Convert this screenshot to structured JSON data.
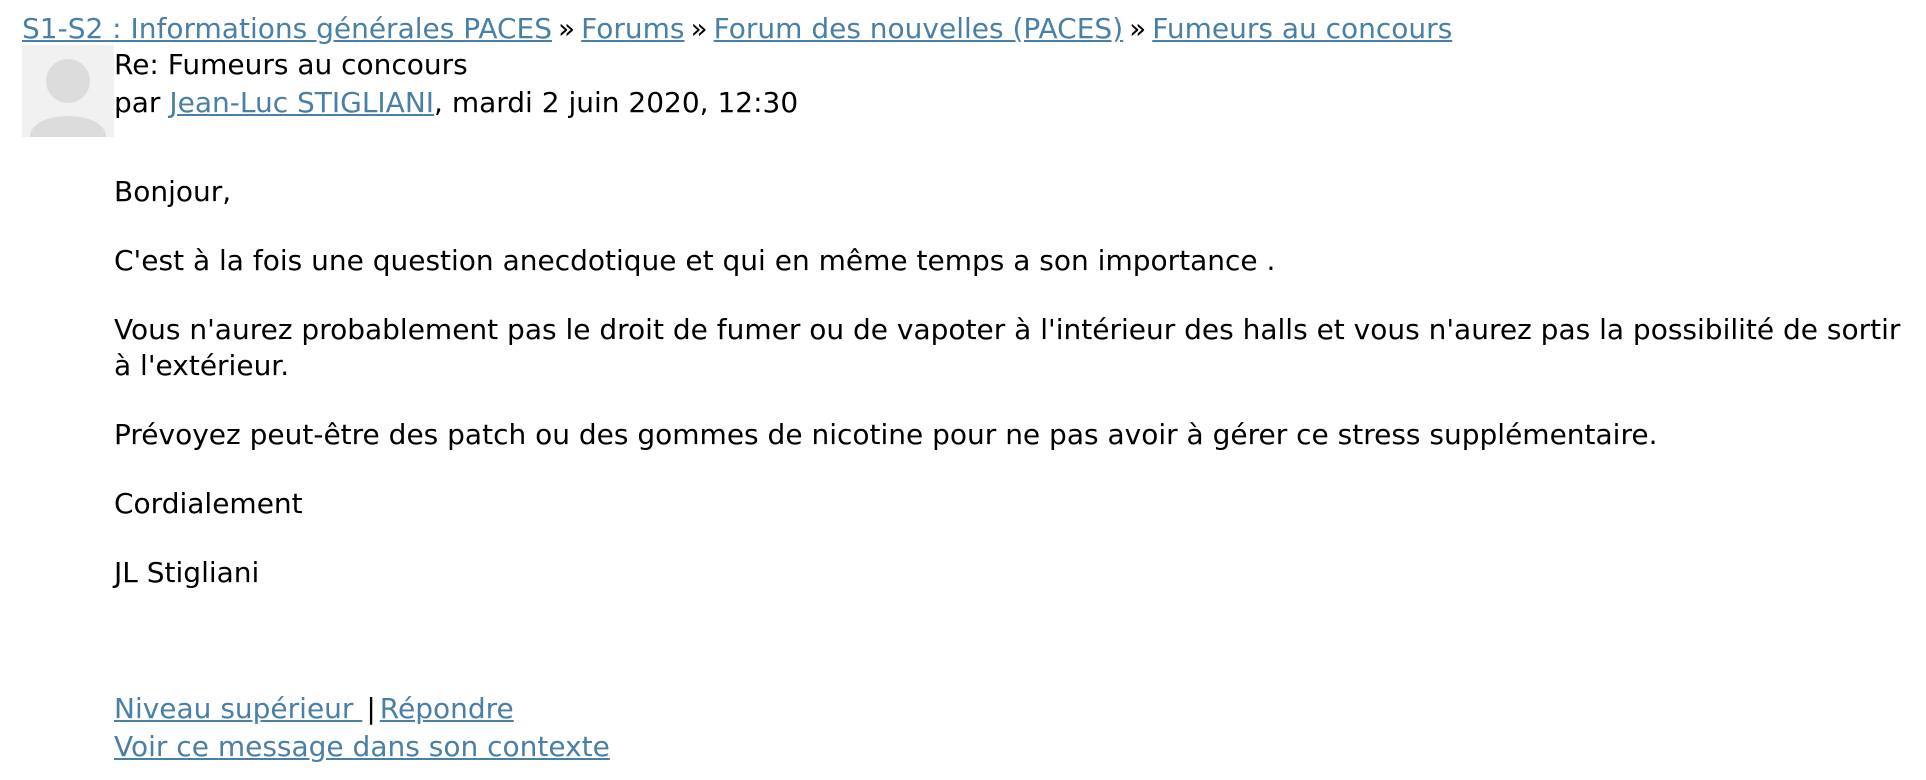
{
  "breadcrumb": {
    "items": [
      "S1-S2 : Informations générales PACES",
      "Forums",
      "Forum des nouvelles (PACES)",
      "Fumeurs au concours"
    ],
    "separator": "»"
  },
  "post": {
    "subject": "Re: Fumeurs au concours",
    "by_prefix": "par ",
    "author": "Jean-Luc STIGLIANI",
    "date": ", mardi 2 juin 2020, 12:30",
    "paragraphs": [
      "Bonjour,",
      "C'est à la fois une question anecdotique et qui en même temps a son importance .",
      "Vous n'aurez probablement pas le droit de fumer ou de vapoter à l'intérieur des halls et vous n'aurez pas la possibilité de sortir à l'extérieur.",
      "Prévoyez peut-être des patch ou des gommes de nicotine pour ne pas avoir à gérer ce stress supplémentaire.",
      "Cordialement",
      "JL Stigliani"
    ]
  },
  "commands": {
    "parent": "Niveau supérieur ",
    "pipe": "|",
    "reply": "Répondre",
    "context": "Voir ce message dans son contexte"
  },
  "colors": {
    "link": "#4a80a6",
    "avatar_bg": "#f1f1f1",
    "avatar_fg": "#dcdcdc"
  },
  "icons": {
    "avatar": "user-silhouette-icon"
  }
}
